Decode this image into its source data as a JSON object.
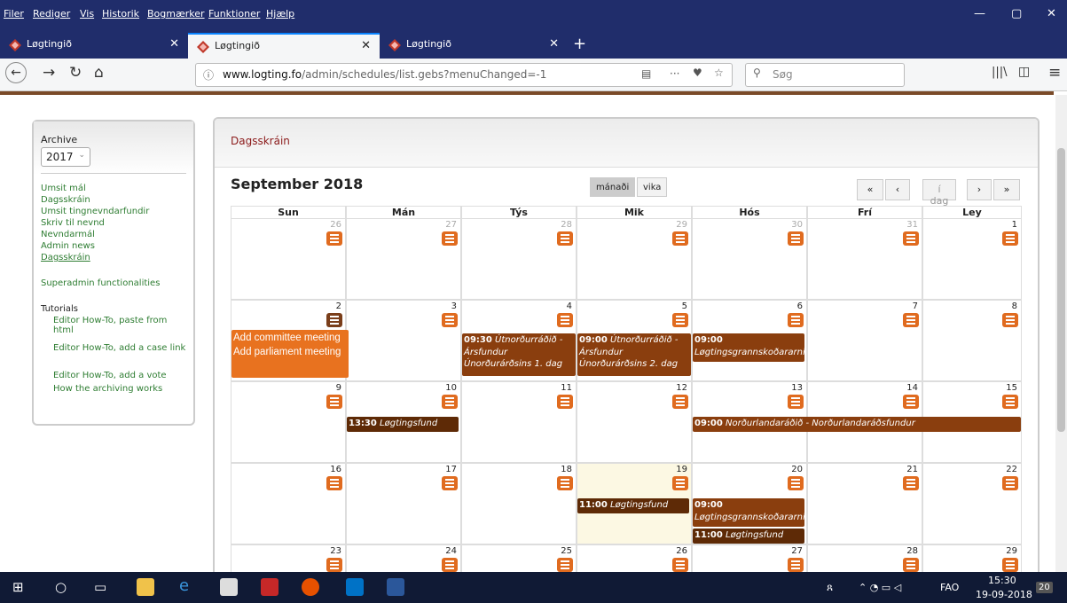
{
  "menu": [
    "Filer",
    "Rediger",
    "Vis",
    "Historik",
    "Bogmærker",
    "Funktioner",
    "Hjælp"
  ],
  "window_controls": {
    "minimize": "—",
    "restore": "▢",
    "close": "✕"
  },
  "tabs": [
    {
      "title": "Løgtingið",
      "active": false
    },
    {
      "title": "Løgtingið",
      "active": true
    },
    {
      "title": "Løgtingið",
      "active": false
    }
  ],
  "new_tab": "+",
  "address": {
    "domain": "www.logting.fo",
    "path": "/admin/schedules/list.gebs?menuChanged=-1"
  },
  "search": {
    "placeholder": "Søg"
  },
  "sidebar": {
    "archive_label": "Archive",
    "year": "2017",
    "links": [
      "Umsit mál",
      "Dagsskráin",
      "Umsit tingnevndarfundir",
      "Skriv til nevnd",
      "Nevndarmál",
      "Admin news",
      "Dagsskráin"
    ],
    "superadmin": "Superadmin functionalities",
    "tutorials_label": "Tutorials",
    "tutorials": [
      "Editor How-To, paste from html",
      "Editor How-To, add a case link",
      "Editor How-To, add a vote",
      "How the archiving works"
    ]
  },
  "main": {
    "title": "Dagsskráin",
    "month": "September 2018",
    "views": [
      "mánaði",
      "vika"
    ],
    "nav": {
      "first": "«",
      "prev": "‹",
      "today": "í dag",
      "next": "›",
      "last": "»"
    },
    "days": [
      "Sun",
      "Mán",
      "Týs",
      "Mik",
      "Hós",
      "Frí",
      "Ley"
    ],
    "weeks": [
      [
        "26",
        "27",
        "28",
        "29",
        "30",
        "31",
        "1"
      ],
      [
        "2",
        "3",
        "4",
        "5",
        "6",
        "7",
        "8"
      ],
      [
        "9",
        "10",
        "11",
        "12",
        "13",
        "14",
        "15"
      ],
      [
        "16",
        "17",
        "18",
        "19",
        "20",
        "21",
        "22"
      ],
      [
        "23",
        "24",
        "25",
        "26",
        "27",
        "28",
        "29"
      ]
    ],
    "popup": {
      "add_committee": "Add committee meeting",
      "add_parliament": "Add parliament meeting"
    },
    "events": {
      "e4_time": "09:30",
      "e4_title": "Útnorðurráðið - Ársfundur Únorðurárðsins 1. dag",
      "e5_time": "09:00",
      "e5_title": "Útnorðurráðið - Ársfundur Únorðurárðsins 2. dag",
      "e6_time": "09:00",
      "e6_title": "Løgtingsgrannskoðararni",
      "e10_time": "13:30",
      "e10_title": "Løgtingsfund",
      "e13_time": "09:00",
      "e13_title": "Norðurlandaráðið - Norðurlandaráðsfundur",
      "e19_time": "11:00",
      "e19_title": "Løgtingsfund",
      "e20a_time": "09:00",
      "e20a_title": "Løgtingsgrannskoðararni",
      "e20b_time": "11:00",
      "e20b_title": "Løgtingsfund"
    }
  },
  "taskbar": {
    "lang": "FAO",
    "time": "15:30",
    "date": "19-09-2018",
    "notifications": "20"
  }
}
